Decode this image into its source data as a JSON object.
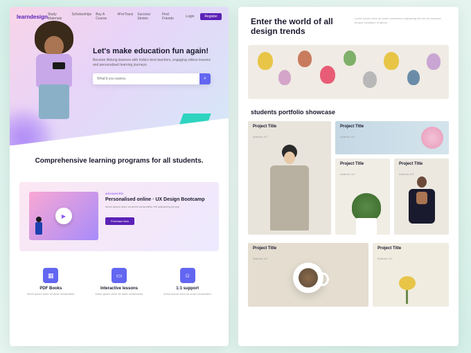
{
  "left": {
    "logo": "learndesign",
    "nav": [
      "Study Materials",
      "Scholarships",
      "Buy A Course",
      "#ForTrans",
      "Success Stories",
      "Find Friends"
    ],
    "login": "Login",
    "register": "Register",
    "hero": {
      "title": "Let's make education fun again!",
      "subtitle": "Become lifelong learners with India's best teachers, engaging videos lessons and personalised learning journeys.",
      "placeholder": "What'd you wanna",
      "search_icon": "⌕"
    },
    "section2_title": "Comprehensive learning programs for all students.",
    "course": {
      "tag": "ADVANCED",
      "title": "Personalised online · UX Design Bootcamp",
      "desc": "lorem ipsum dolor sit amet consectetur elit adipiscing tempor",
      "cta": "Purchase Now"
    },
    "features": [
      {
        "icon": "▦",
        "title": "PDF Books",
        "desc": "lorem ipsum dolor sit amet consectetur"
      },
      {
        "icon": "▭",
        "title": "Interactive lessons",
        "desc": "lorem ipsum dolor sit amet consectetur"
      },
      {
        "icon": "☺",
        "title": "1:1 support",
        "desc": "lorem ipsum dolor sit amet consectetur"
      }
    ]
  },
  "right": {
    "head_title": "Enter the world of all design trends",
    "head_desc": "Lorem ipsum dolor sit amet consectetur adipiscing elit sed do eiusmod tempor incididunt ut labore",
    "portfolio_label": "students portfolio showcase",
    "cards": [
      {
        "title": "Project Title",
        "sub": "Android, IoT"
      },
      {
        "title": "Project Title",
        "sub": "Android, IoT"
      },
      {
        "title": "Project Title",
        "sub": "Android, IoT"
      },
      {
        "title": "Project Title",
        "sub": "Android, IoT"
      },
      {
        "title": "Project Title",
        "sub": "Android, IoT"
      },
      {
        "title": "Project Title",
        "sub": "Android, IoT"
      }
    ]
  }
}
